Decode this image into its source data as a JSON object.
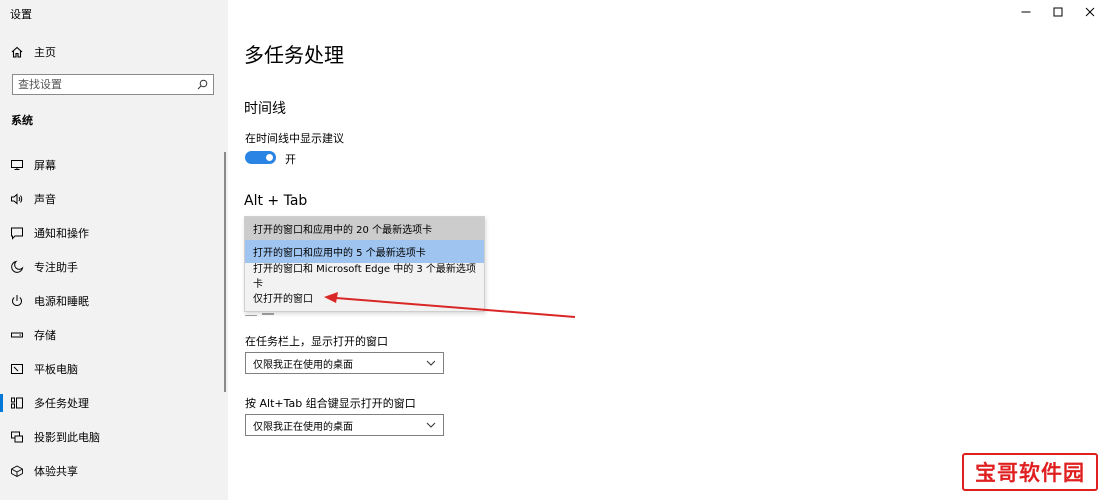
{
  "window": {
    "title": "设置",
    "controls": [
      "minimize",
      "maximize",
      "close"
    ]
  },
  "sidebar": {
    "home_label": "主页",
    "search": {
      "placeholder": "查找设置",
      "value": ""
    },
    "section_label": "系统",
    "items": [
      {
        "label": "屏幕",
        "icon": "display-icon"
      },
      {
        "label": "声音",
        "icon": "speaker-icon"
      },
      {
        "label": "通知和操作",
        "icon": "notification-icon"
      },
      {
        "label": "专注助手",
        "icon": "moon-icon"
      },
      {
        "label": "电源和睡眠",
        "icon": "power-icon"
      },
      {
        "label": "存储",
        "icon": "storage-icon"
      },
      {
        "label": "平板电脑",
        "icon": "tablet-icon"
      },
      {
        "label": "多任务处理",
        "icon": "multitasking-icon",
        "active": true
      },
      {
        "label": "投影到此电脑",
        "icon": "project-icon"
      },
      {
        "label": "体验共享",
        "icon": "share-icon"
      }
    ]
  },
  "main": {
    "page_title": "多任务处理",
    "timeline": {
      "heading": "时间线",
      "setting_label": "在时间线中显示建议",
      "toggle_on": true,
      "toggle_state_label": "开"
    },
    "alt_tab": {
      "heading": "Alt + Tab",
      "options": [
        "打开的窗口和应用中的 20 个最新选项卡",
        "打开的窗口和应用中的 5 个最新选项卡",
        "打开的窗口和 Microsoft Edge 中的 3 个最新选项卡",
        "仅打开的窗口"
      ],
      "hovered_index": 0,
      "selected_index": 1
    },
    "taskbar_setting": {
      "label": "在任务栏上，显示打开的窗口",
      "value": "仅限我正在使用的桌面"
    },
    "alt_tab_setting": {
      "label": "按 Alt+Tab 组合键显示打开的窗口",
      "value": "仅限我正在使用的桌面"
    }
  },
  "annotation": {
    "type": "red-arrow",
    "target": "仅打开的窗口"
  },
  "watermark": {
    "text": "宝哥软件园"
  },
  "colors": {
    "accent": "#0078d7",
    "toggle": "#2a84e4",
    "selected_option": "#9fc4f0",
    "arrow": "#d92626",
    "watermark": "#e02020"
  }
}
